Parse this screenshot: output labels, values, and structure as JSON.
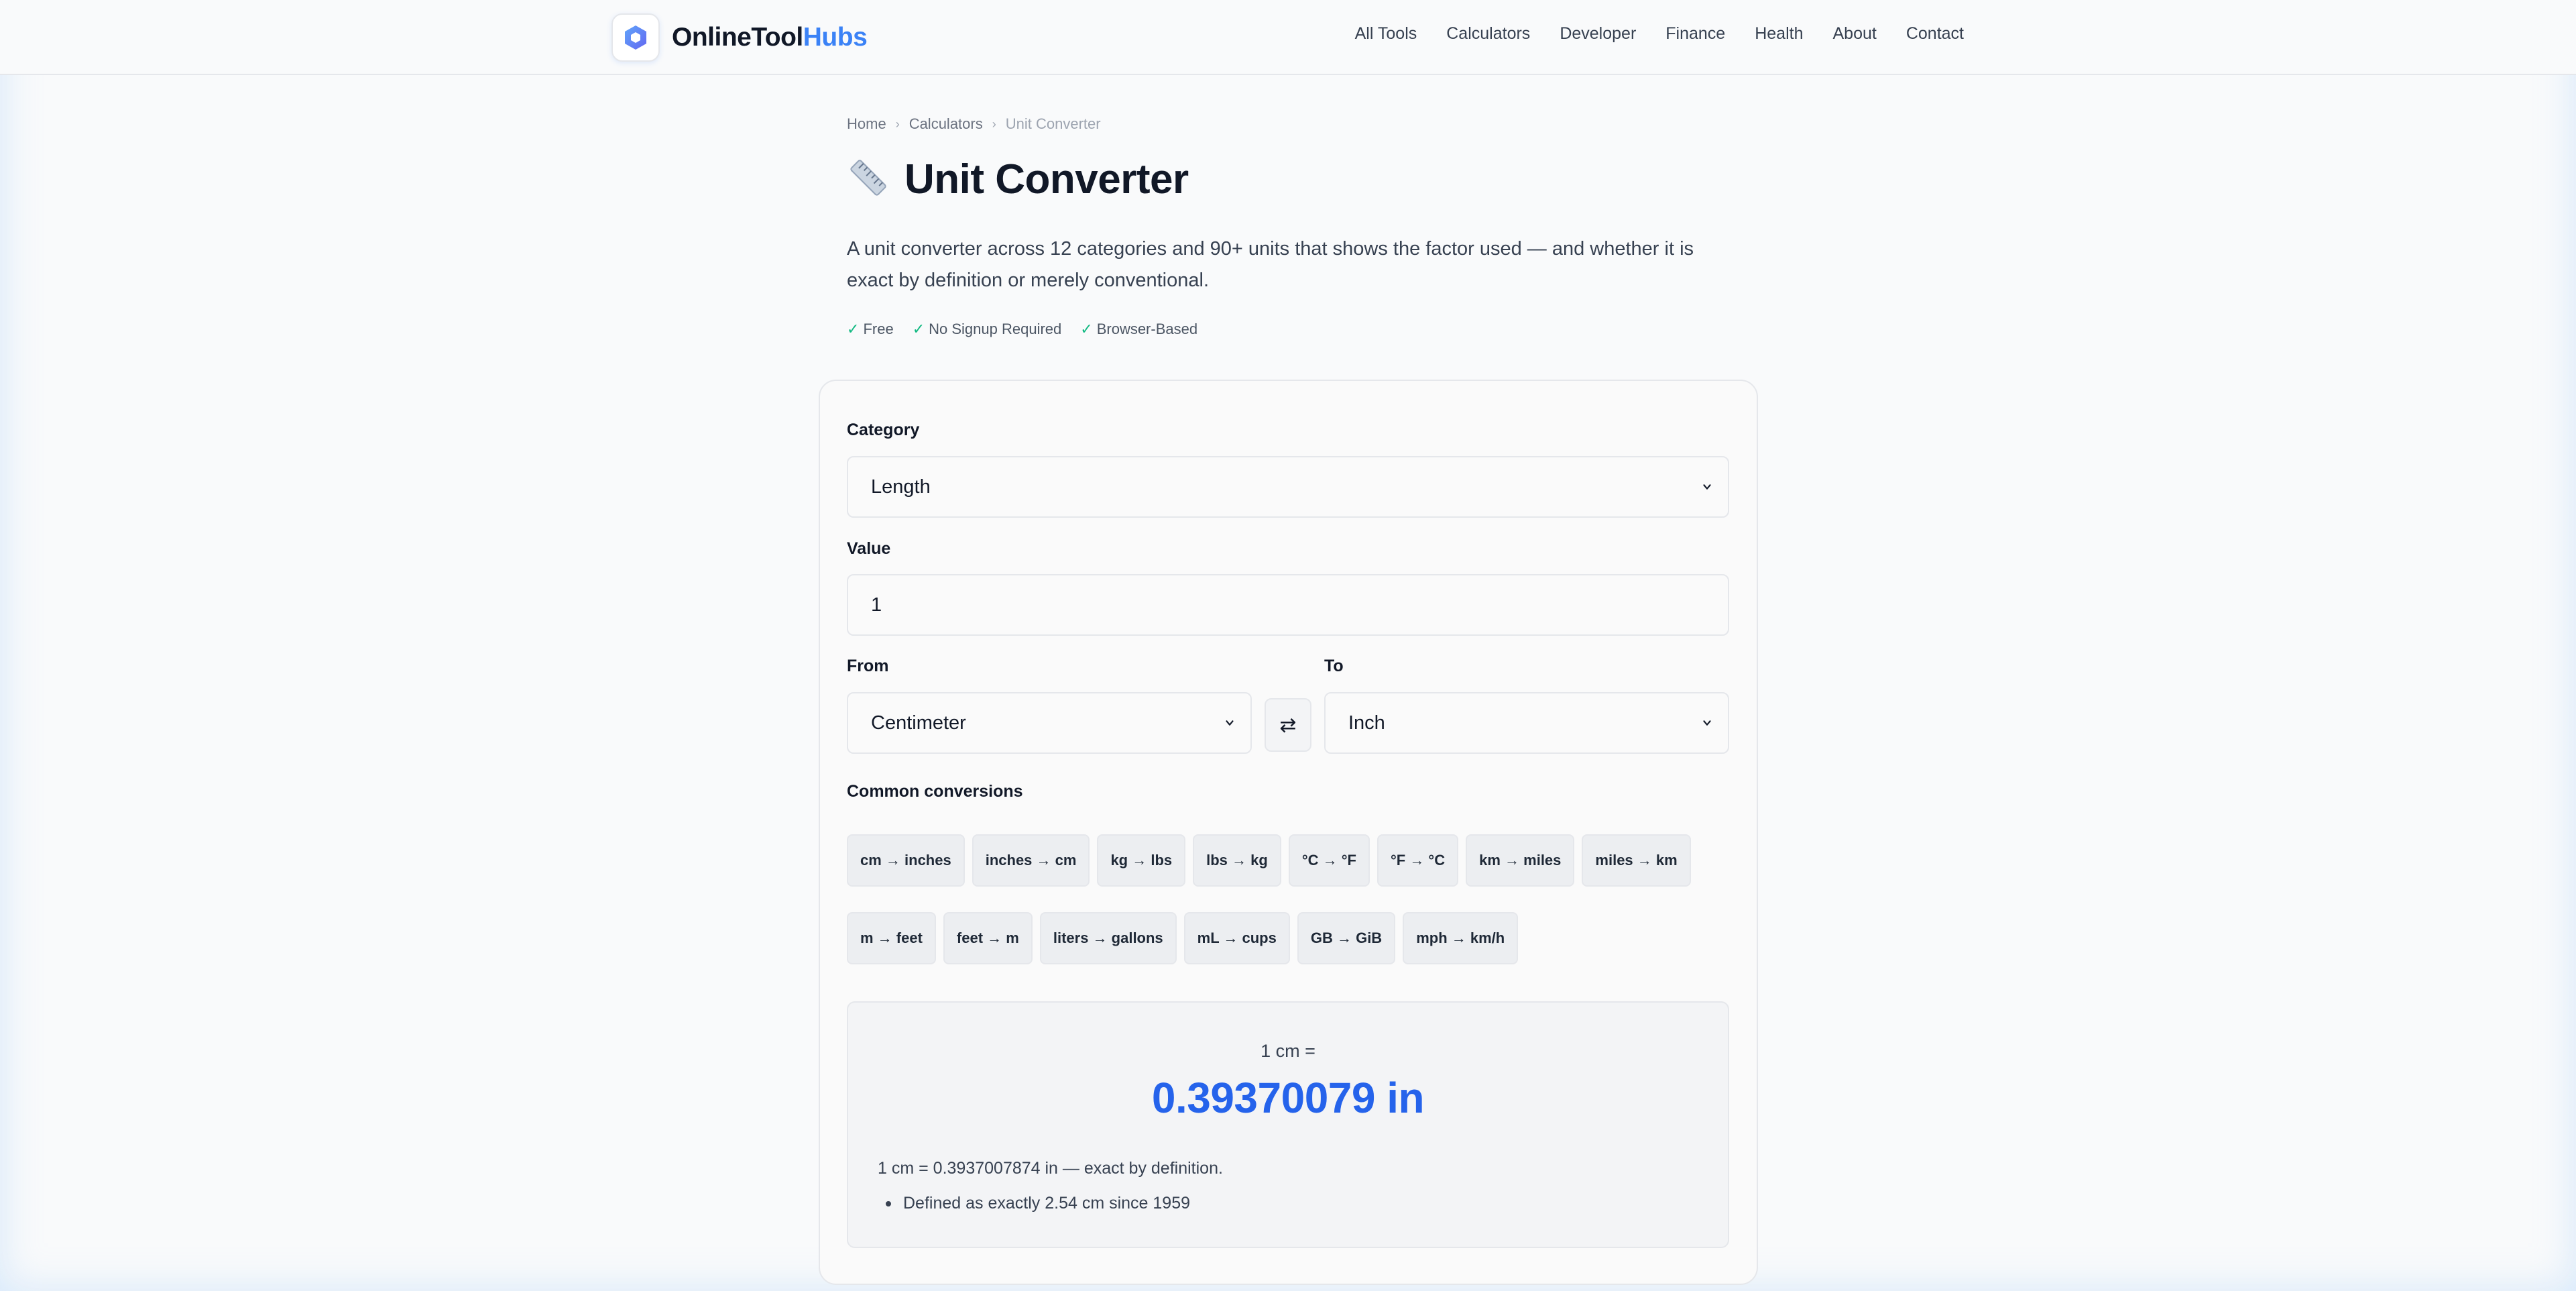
{
  "header": {
    "brand_primary": "OnlineTool",
    "brand_accent": "Hubs",
    "logo_icon": "hexagon-logo-icon",
    "nav": [
      "All Tools",
      "Calculators",
      "Developer",
      "Finance",
      "Health",
      "About",
      "Contact"
    ]
  },
  "breadcrumb": [
    "Home",
    "Calculators",
    "Unit Converter"
  ],
  "page": {
    "title_icon": "ruler-icon",
    "title": "Unit Converter",
    "description": "A unit converter across 12 categories and 90+ units that shows the factor used — and whether it is exact by definition or merely conventional.",
    "badges": [
      "Free",
      "No Signup Required",
      "Browser-Based"
    ]
  },
  "form": {
    "category_label": "Category",
    "category_value": "Length",
    "value_label": "Value",
    "value": "1",
    "from_label": "From",
    "from_value": "Centimeter",
    "to_label": "To",
    "to_value": "Inch",
    "swap_icon": "⇄",
    "common_label": "Common conversions",
    "common_row1": [
      "cm → inches",
      "inches → cm",
      "kg → lbs",
      "lbs → kg",
      "°C → °F",
      "°F → °C",
      "km → miles",
      "miles → km"
    ],
    "common_row2": [
      "m → feet",
      "feet → m",
      "liters → gallons",
      "mL → cups",
      "GB → GiB",
      "mph → km/h"
    ]
  },
  "result": {
    "head": "1 cm =",
    "main": "0.39370079 in",
    "note": "1 cm = 0.3937007874 in — exact by definition.",
    "detail": "Defined as exactly 2.54 cm since 1959"
  },
  "colors": {
    "accent": "#2563eb",
    "brand_accent": "#3b82f6",
    "check": "#10b981"
  }
}
